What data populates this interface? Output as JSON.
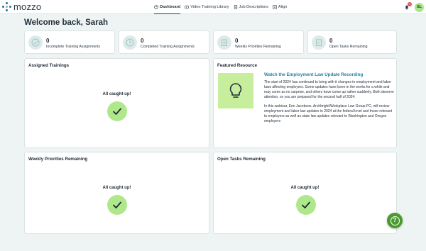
{
  "header": {
    "logo_text": "mozzo",
    "nav": [
      {
        "label": "Dashboard",
        "icon": "dashboard-icon",
        "active": true
      },
      {
        "label": "Video Training Library",
        "icon": "video-icon",
        "active": false
      },
      {
        "label": "Job Descriptions",
        "icon": "document-icon",
        "active": false
      },
      {
        "label": "Align",
        "icon": "align-icon",
        "active": false
      }
    ],
    "notification_count": "1",
    "avatar_initials": "GL"
  },
  "welcome": "Welcome back, Sarah",
  "stats": [
    {
      "value": "0",
      "label": "Incomplete Training Assignments",
      "icon": "tasks-icon"
    },
    {
      "value": "0",
      "label": "Completed Training Assignments",
      "icon": "clock-check-icon"
    },
    {
      "value": "0",
      "label": "Weekly Priorities Remaining",
      "icon": "clipboard-icon"
    },
    {
      "value": "0",
      "label": "Open Tasks Remaining",
      "icon": "checklist-icon"
    }
  ],
  "assigned_trainings": {
    "title": "Assigned Trainings",
    "status": "All caught up!"
  },
  "featured": {
    "title": "Featured Resource",
    "link": "Watch the Employment Law Update Recording",
    "paragraph1": "The start of 2024 has continued to bring with it changes in employment and labor laws affecting employers. Some updates have been in the works for a while and may come as no surprise, and others have come up rather suddenly. Both deserve attention, so you are prepared for the second half of 2024.",
    "paragraph2": "In this webinar, Erin Jacobson, Archbright/Workplace Law Group PC, will review employment and labor law updates in 2024 at the federal level and those relevant to employers as well as state law updates relevant to Washington and Oregon employers",
    "image_icon": "lightbulb-icon"
  },
  "weekly_priorities": {
    "title": "Weekly Priorities Remaining",
    "status": "All caught up!"
  },
  "open_tasks": {
    "title": "Open Tasks Remaining",
    "status": "All caught up!"
  },
  "help_label": "?",
  "colors": {
    "accent_green": "#aee88a",
    "link_blue": "#2a7fa5",
    "help_green": "#4a9a2f",
    "background": "#eef4f4"
  }
}
